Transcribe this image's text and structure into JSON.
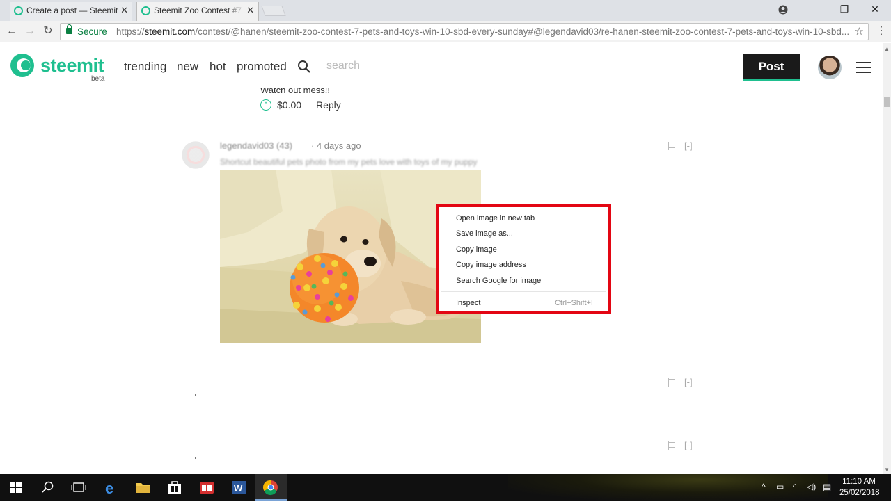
{
  "browser": {
    "tabs": [
      {
        "title": "Create a post — Steemit"
      },
      {
        "title": "Steemit Zoo Contest #7"
      }
    ],
    "address": {
      "secure_label": "Secure",
      "scheme": "https://",
      "host": "steemit.com",
      "path": "/contest/@hanen/steemit-zoo-contest-7-pets-and-toys-win-10-sbd-every-sunday#@legendavid03/re-hanen-steemit-zoo-contest-7-pets-and-toys-win-10-sbd..."
    }
  },
  "header": {
    "brand": "steemit",
    "beta": "beta",
    "nav": [
      "trending",
      "new",
      "hot",
      "promoted"
    ],
    "search_placeholder": "search",
    "post_label": "Post"
  },
  "prev_comment": {
    "cut_text": "Watch out mess!!",
    "payout": "$0.00",
    "reply_label": "Reply"
  },
  "comment": {
    "author": "legendavid03 (43)",
    "when": "· 4 days ago",
    "body": "Shortcut beautiful pets photo from my pets love with toys of my puppy",
    "collapse_label": "[-]"
  },
  "more_comments": [
    {
      "collapse_label": "[-]"
    },
    {
      "collapse_label": "[-]"
    }
  ],
  "context_menu": {
    "items": [
      "Open image in new tab",
      "Save image as...",
      "Copy image",
      "Copy image address",
      "Search Google for image"
    ],
    "inspect_label": "Inspect",
    "inspect_shortcut": "Ctrl+Shift+I",
    "highlight_color": "#e30613"
  },
  "taskbar": {
    "time": "11:10 AM",
    "date": "25/02/2018"
  },
  "colors": {
    "brand": "#1fbf8f",
    "post_button": "#1a1a1a"
  }
}
